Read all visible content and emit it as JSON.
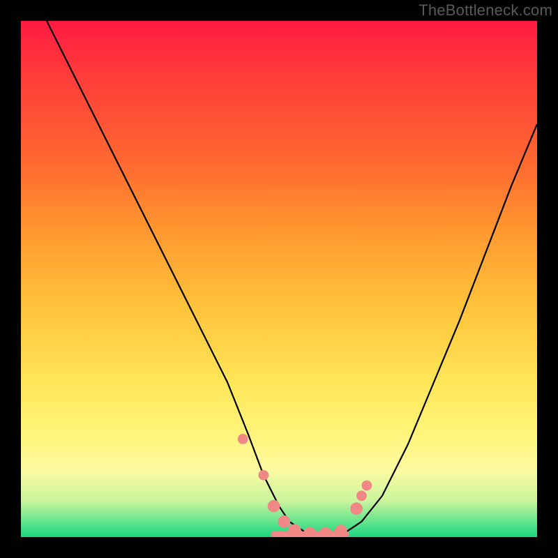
{
  "watermark": "TheBottleneck.com",
  "chart_data": {
    "type": "line",
    "title": "",
    "xlabel": "",
    "ylabel": "",
    "xlim": [
      0,
      100
    ],
    "ylim": [
      0,
      100
    ],
    "curve_left": {
      "name": "left-branch",
      "x": [
        5,
        10,
        15,
        20,
        25,
        30,
        35,
        40,
        44,
        47,
        50,
        52,
        55,
        58,
        60
      ],
      "y": [
        100,
        90,
        80,
        70,
        60,
        50,
        40,
        30,
        20,
        12,
        6,
        3,
        1,
        0,
        0
      ]
    },
    "curve_right": {
      "name": "right-branch",
      "x": [
        60,
        63,
        66,
        70,
        75,
        80,
        85,
        90,
        95,
        100
      ],
      "y": [
        0,
        1,
        3,
        8,
        18,
        30,
        42,
        55,
        68,
        80
      ]
    },
    "trough_plateau": {
      "x": [
        49,
        63
      ],
      "y": 0.5
    },
    "markers": [
      {
        "x": 43,
        "y": 19,
        "r": 1.0
      },
      {
        "x": 47,
        "y": 12,
        "r": 1.0
      },
      {
        "x": 49,
        "y": 6,
        "r": 1.2
      },
      {
        "x": 51,
        "y": 3,
        "r": 1.2
      },
      {
        "x": 53,
        "y": 1.2,
        "r": 1.3
      },
      {
        "x": 56,
        "y": 0.6,
        "r": 1.3
      },
      {
        "x": 59,
        "y": 0.6,
        "r": 1.3
      },
      {
        "x": 62,
        "y": 1.2,
        "r": 1.2
      },
      {
        "x": 65,
        "y": 5.5,
        "r": 1.2
      },
      {
        "x": 66,
        "y": 8,
        "r": 1.0
      },
      {
        "x": 67,
        "y": 10,
        "r": 1.0
      }
    ],
    "marker_color": "#f08986",
    "curve_color": "#000000",
    "curve_width": 2
  }
}
